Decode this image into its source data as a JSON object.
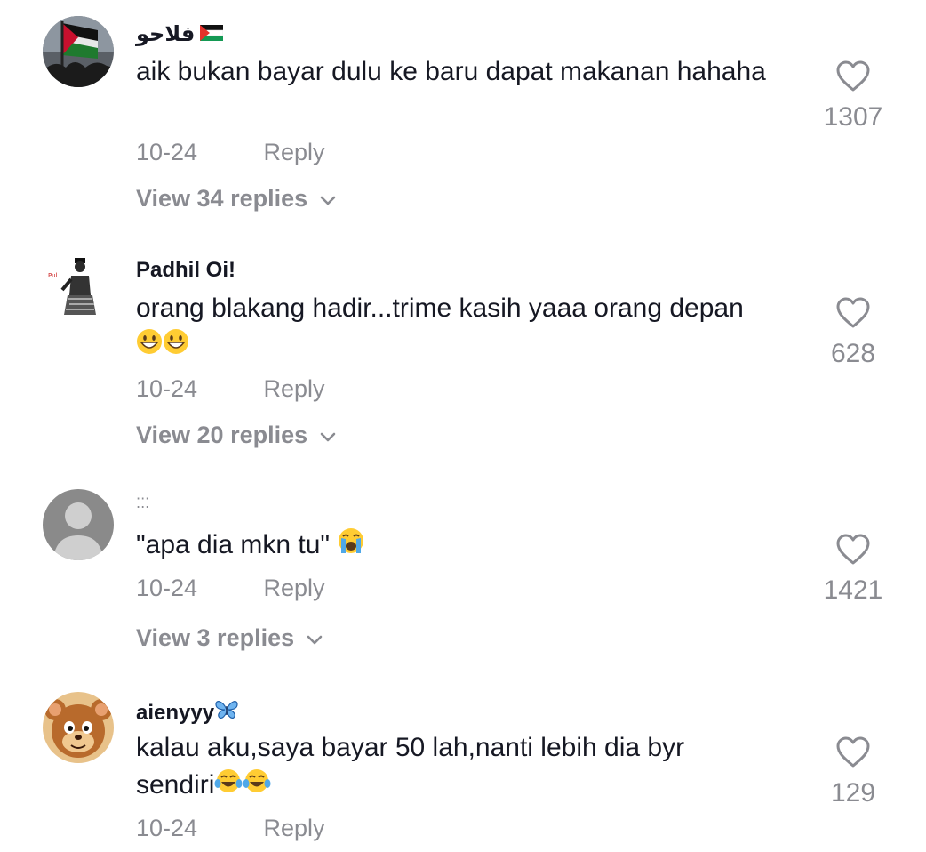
{
  "comments": [
    {
      "username": "فلاحو",
      "username_suffix_icon": "palestine-flag-icon",
      "text": "aik bukan bayar dulu ke baru dapat makanan hahaha",
      "date": "10-24",
      "reply_label": "Reply",
      "view_replies": "View 34 replies",
      "likes": "1307",
      "avatar_icon": "flag-crowd-avatar"
    },
    {
      "username": "Padhil Oi!",
      "text": "orang blakang hadir...trime kasih yaaa orang depan",
      "text_emojis": [
        "grinning-face",
        "grinning-face"
      ],
      "date": "10-24",
      "reply_label": "Reply",
      "view_replies": "View 20 replies",
      "likes": "628",
      "avatar_icon": "dancing-man-avatar"
    },
    {
      "username": "⁚⁚⁚",
      "text": "\"apa dia mkn tu\"",
      "text_emojis": [
        "crying-face"
      ],
      "date": "10-24",
      "reply_label": "Reply",
      "view_replies": "View 3 replies",
      "likes": "1421",
      "avatar_icon": "default-user-avatar"
    },
    {
      "username": "aienyyy",
      "username_suffix_icon": "butterfly-icon",
      "text_line1": "kalau aku,saya bayar 50 lah,nanti lebih dia byr",
      "text_line2": "sendiri",
      "text_emojis": [
        "tears-of-joy",
        "tears-of-joy"
      ],
      "date": "10-24",
      "reply_label": "Reply",
      "likes": "129",
      "avatar_icon": "cartoon-mouse-avatar"
    }
  ],
  "colors": {
    "text": "#161823",
    "muted": "#8a8b91",
    "background": "#ffffff"
  }
}
